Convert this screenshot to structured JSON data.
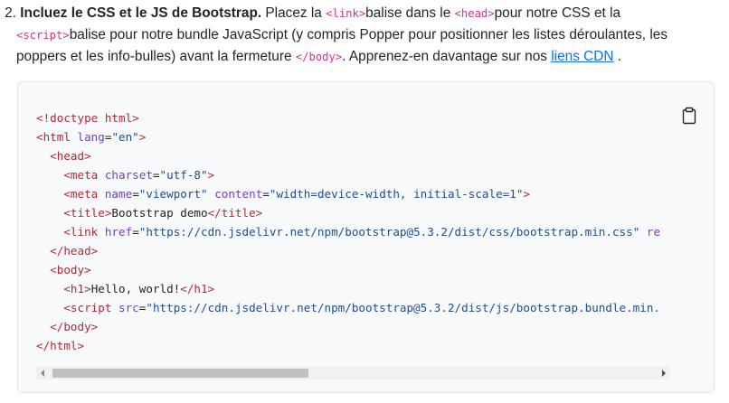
{
  "step": {
    "number": "2.",
    "title": "Incluez le CSS et le JS de Bootstrap.",
    "text_1": " Placez la ",
    "code_link": "<link>",
    "text_2": "balise dans le ",
    "code_head": "<head>",
    "text_3": "pour notre CSS et la",
    "code_script": "<script>",
    "text_4": "balise pour notre bundle JavaScript (y compris Popper pour positionner les listes déroulantes, les",
    "text_5": "poppers et les info-bulles) avant la fermeture ",
    "code_body": "</body>",
    "text_6": ". Apprenez-en davantage sur nos ",
    "link_label": "liens CDN",
    "text_7": " ."
  },
  "code_block": {
    "copy_icon": "clipboard-icon",
    "lines": [
      [
        {
          "t": "tag",
          "v": "<!doctype html>"
        }
      ],
      [
        {
          "t": "tag",
          "v": "<html "
        },
        {
          "t": "attr",
          "v": "lang"
        },
        {
          "t": "txt",
          "v": "="
        },
        {
          "t": "str",
          "v": "\"en\""
        },
        {
          "t": "tag",
          "v": ">"
        }
      ],
      [
        {
          "t": "txt",
          "v": "  "
        },
        {
          "t": "tag",
          "v": "<head>"
        }
      ],
      [
        {
          "t": "txt",
          "v": "    "
        },
        {
          "t": "tag",
          "v": "<meta "
        },
        {
          "t": "attr",
          "v": "charset"
        },
        {
          "t": "txt",
          "v": "="
        },
        {
          "t": "str",
          "v": "\"utf-8\""
        },
        {
          "t": "tag",
          "v": ">"
        }
      ],
      [
        {
          "t": "txt",
          "v": "    "
        },
        {
          "t": "tag",
          "v": "<meta "
        },
        {
          "t": "attr",
          "v": "name"
        },
        {
          "t": "txt",
          "v": "="
        },
        {
          "t": "str",
          "v": "\"viewport\""
        },
        {
          "t": "txt",
          "v": " "
        },
        {
          "t": "attr",
          "v": "content"
        },
        {
          "t": "txt",
          "v": "="
        },
        {
          "t": "str",
          "v": "\"width=device-width, initial-scale=1\""
        },
        {
          "t": "tag",
          "v": ">"
        }
      ],
      [
        {
          "t": "txt",
          "v": "    "
        },
        {
          "t": "tag",
          "v": "<title>"
        },
        {
          "t": "txt",
          "v": "Bootstrap demo"
        },
        {
          "t": "tag",
          "v": "</title>"
        }
      ],
      [
        {
          "t": "txt",
          "v": "    "
        },
        {
          "t": "tag",
          "v": "<link "
        },
        {
          "t": "attr",
          "v": "href"
        },
        {
          "t": "txt",
          "v": "="
        },
        {
          "t": "str",
          "v": "\"https://cdn.jsdelivr.net/npm/bootstrap@5.3.2/dist/css/bootstrap.min.css\""
        },
        {
          "t": "txt",
          "v": " "
        },
        {
          "t": "attr",
          "v": "re"
        }
      ],
      [
        {
          "t": "txt",
          "v": "  "
        },
        {
          "t": "tag",
          "v": "</head>"
        }
      ],
      [
        {
          "t": "txt",
          "v": "  "
        },
        {
          "t": "tag",
          "v": "<body>"
        }
      ],
      [
        {
          "t": "txt",
          "v": "    "
        },
        {
          "t": "tag",
          "v": "<h1>"
        },
        {
          "t": "txt",
          "v": "Hello, world!"
        },
        {
          "t": "tag",
          "v": "</h1>"
        }
      ],
      [
        {
          "t": "txt",
          "v": "    "
        },
        {
          "t": "tag",
          "v": "<script "
        },
        {
          "t": "attr",
          "v": "src"
        },
        {
          "t": "txt",
          "v": "="
        },
        {
          "t": "str",
          "v": "\"https://cdn.jsdelivr.net/npm/bootstrap@5.3.2/dist/js/bootstrap.bundle.min."
        }
      ],
      [
        {
          "t": "txt",
          "v": "  "
        },
        {
          "t": "tag",
          "v": "</body>"
        }
      ],
      [
        {
          "t": "tag",
          "v": "</html>"
        }
      ]
    ],
    "scroll_position": 0.0
  },
  "colors": {
    "inline_code": "#d63384",
    "link": "#0d6efd",
    "code_bg": "#f8f9fa",
    "tag": "#b02a37",
    "attr": "#6f42c1",
    "string": "#1f4d8f"
  }
}
